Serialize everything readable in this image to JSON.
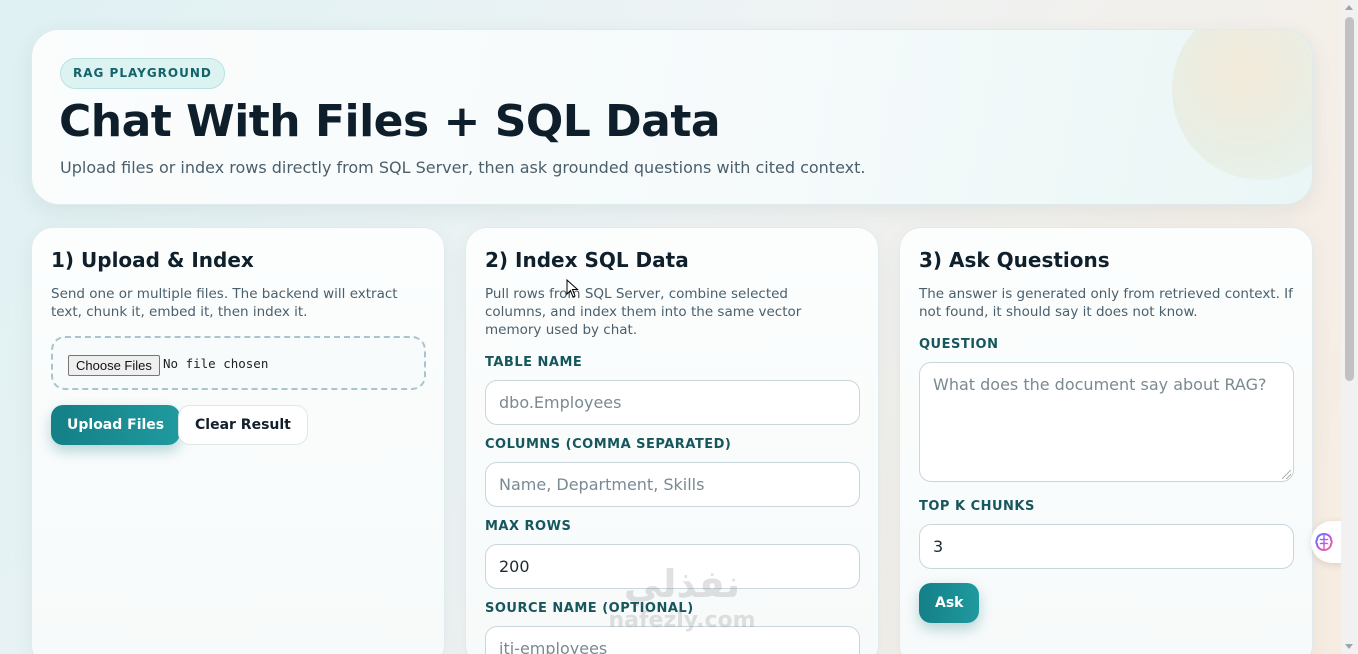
{
  "hero": {
    "badge": "RAG PLAYGROUND",
    "title": "Chat With Files + SQL Data",
    "subtitle": "Upload files or index rows directly from SQL Server, then ask grounded questions with cited context."
  },
  "upload": {
    "title": "1) Upload & Index",
    "description": "Send one or multiple files. The backend will extract text, chunk it, embed it, then index it.",
    "choose_files_label": "Choose Files",
    "no_file_text": "No file chosen",
    "upload_button": "Upload Files",
    "clear_button": "Clear Result"
  },
  "sql": {
    "title": "2) Index SQL Data",
    "description": "Pull rows from SQL Server, combine selected columns, and index them into the same vector memory used by chat.",
    "table_label": "TABLE NAME",
    "table_placeholder": "dbo.Employees",
    "columns_label": "COLUMNS (COMMA SEPARATED)",
    "columns_placeholder": "Name, Department, Skills",
    "max_rows_label": "MAX ROWS",
    "max_rows_value": "200",
    "source_label": "SOURCE NAME (OPTIONAL)",
    "source_placeholder": "iti-employees"
  },
  "ask": {
    "title": "3) Ask Questions",
    "description": "The answer is generated only from retrieved context. If not found, it should say it does not know.",
    "question_label": "QUESTION",
    "question_placeholder": "What does the document say about RAG?",
    "topk_label": "TOP K CHUNKS",
    "topk_value": "3",
    "ask_button": "Ask"
  },
  "watermark": {
    "arabic": "نفذلي",
    "latin": "nafezly.com"
  },
  "colors": {
    "accent": "#147f87",
    "label": "#17565c",
    "title": "#0e1e2b"
  },
  "icons": {
    "side_fab": "brain-icon"
  }
}
